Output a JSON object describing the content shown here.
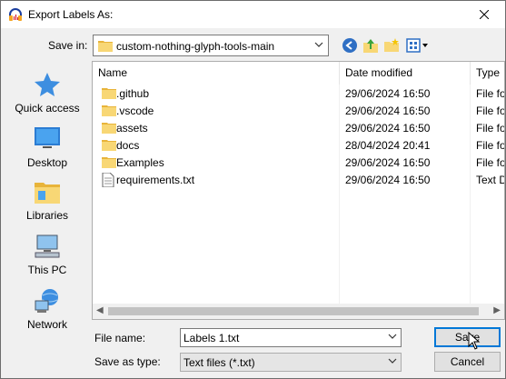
{
  "window": {
    "title": "Export Labels As:"
  },
  "savein": {
    "label": "Save in:",
    "value": "custom-nothing-glyph-tools-main"
  },
  "places": [
    {
      "label": "Quick access",
      "icon": "star-icon"
    },
    {
      "label": "Desktop",
      "icon": "desktop-icon"
    },
    {
      "label": "Libraries",
      "icon": "libraries-icon"
    },
    {
      "label": "This PC",
      "icon": "computer-icon"
    },
    {
      "label": "Network",
      "icon": "network-icon"
    }
  ],
  "columns": {
    "name": "Name",
    "date": "Date modified",
    "type": "Type"
  },
  "files": [
    {
      "name": ".github",
      "date": "29/06/2024 16:50",
      "type": "File fo",
      "kind": "folder"
    },
    {
      "name": ".vscode",
      "date": "29/06/2024 16:50",
      "type": "File fo",
      "kind": "folder"
    },
    {
      "name": "assets",
      "date": "29/06/2024 16:50",
      "type": "File fo",
      "kind": "folder"
    },
    {
      "name": "docs",
      "date": "28/04/2024 20:41",
      "type": "File fo",
      "kind": "folder"
    },
    {
      "name": "Examples",
      "date": "29/06/2024 16:50",
      "type": "File fo",
      "kind": "folder"
    },
    {
      "name": "requirements.txt",
      "date": "29/06/2024 16:50",
      "type": "Text D",
      "kind": "text"
    }
  ],
  "filename": {
    "label": "File name:",
    "value": "Labels 1.txt"
  },
  "savetype": {
    "label": "Save as type:",
    "value": "Text files (*.txt)"
  },
  "buttons": {
    "save": "Save",
    "cancel": "Cancel"
  },
  "colors": {
    "accent": "#0078d7",
    "folder": "#f8d775"
  }
}
